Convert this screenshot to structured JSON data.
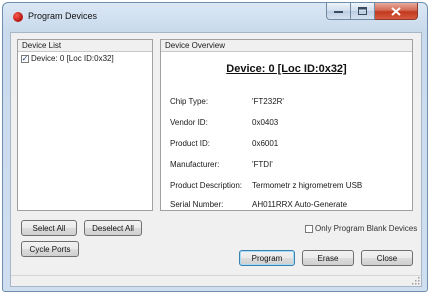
{
  "window": {
    "title": "Program Devices"
  },
  "device_list": {
    "header": "Device List",
    "items": [
      {
        "label": "Device: 0 [Loc ID:0x32]",
        "checked": true
      }
    ]
  },
  "overview": {
    "header": "Device Overview",
    "title": "Device: 0 [Loc ID:0x32]",
    "fields": [
      {
        "label": "Chip Type:",
        "value": "'FT232R'"
      },
      {
        "label": "Vendor ID:",
        "value": "0x0403"
      },
      {
        "label": "Product ID:",
        "value": "0x6001"
      },
      {
        "label": "Manufacturer:",
        "value": "'FTDI'"
      },
      {
        "label": "Product Description:",
        "value": "Termometr z higrometrem USB"
      },
      {
        "label": "Serial Number:",
        "value": "AH011RRX Auto-Generate"
      }
    ]
  },
  "buttons": {
    "select_all": "Select All",
    "deselect_all": "Deselect All",
    "cycle_ports": "Cycle Ports",
    "program": "Program",
    "erase": "Erase",
    "close": "Close"
  },
  "options": {
    "only_blank": "Only Program Blank Devices",
    "only_blank_checked": false
  }
}
